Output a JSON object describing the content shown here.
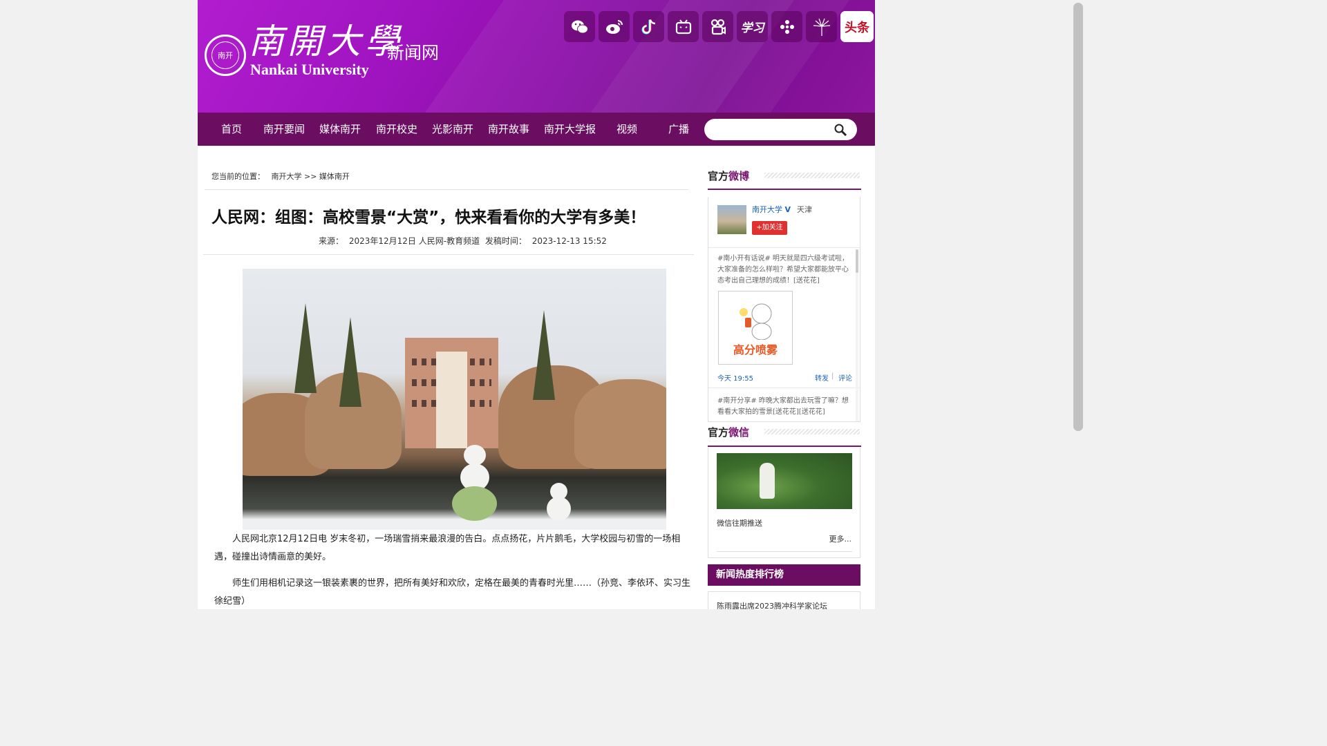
{
  "header": {
    "logo_cn": "南開大學",
    "logo_en": "Nankai University",
    "site_name": "新闻网",
    "seal_text": "南开",
    "social_icons": [
      "wechat-icon",
      "weibo-icon",
      "douyin-icon",
      "bilibili-icon",
      "kuaishou-icon",
      "xuexi-icon",
      "zhihu-icon",
      "dandelion-icon",
      "toutiao-icon"
    ],
    "social_labels": {
      "xuexi": "学习",
      "toutiao": "头条"
    }
  },
  "nav": {
    "items": [
      "首页",
      "南开要闻",
      "媒体南开",
      "南开校史",
      "光影南开",
      "南开故事",
      "南开大学报",
      "视频",
      "广播"
    ],
    "search_placeholder": ""
  },
  "breadcrumb": {
    "prefix": "您当前的位置：",
    "path": "南开大学 >> 媒体南开"
  },
  "article": {
    "title": "人民网：组图：高校雪景“大赏”，快来看看你的大学有多美！",
    "source_label": "来源：",
    "source": "2023年12月12日 人民网-教育频道",
    "date_label": "发稿时间：",
    "date": "2023-12-13 15:52",
    "paragraphs": [
      "人民网北京12月12日电 岁末冬初，一场瑞雪捎来最浪漫的告白。点点扬花，片片鹅毛，大学校园与初雪的一场相遇，碰撞出诗情画意的美好。",
      "师生们用相机记录这一银装素裹的世界，把所有美好和欢欣，定格在最美的青春时光里……（孙竞、李依环、实习生徐纪雪）"
    ]
  },
  "weibo": {
    "head_a": "官方",
    "head_b": "微博",
    "account": "南开大学",
    "verified": "V",
    "city": "天津",
    "follow": "+加关注",
    "post1": "#南小开有话说# 明天就是四六级考试啦，大家准备的怎么样啦？希望大家都能放平心态考出自己理想的成绩！[送花花]",
    "post1_image_text": "高分喷雾",
    "post1_time": "今天 19:55",
    "repost": "转发",
    "divider": "|",
    "comment": "评论",
    "post2": "#南开分享# 昨晚大家都出去玩雪了嘛？想看看大家拍的雪景[送花花][送花花]"
  },
  "wechat": {
    "head_a": "官方",
    "head_b": "微信",
    "label": "微信往期推送",
    "more": "更多..."
  },
  "hot": {
    "title": "新闻热度排行榜",
    "items": [
      "陈雨露出席2023腾冲科学家论坛"
    ]
  },
  "colors": {
    "brand_purple": "#6b0e61",
    "header_purple": "#a014c0",
    "accent": "#7a1470",
    "link_blue": "#1a63b8",
    "follow_red": "#e13030"
  }
}
